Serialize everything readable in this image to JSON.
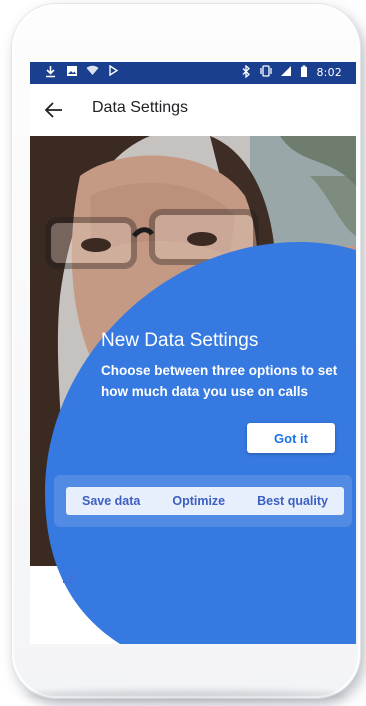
{
  "status_bar": {
    "left_icons": [
      "download-icon",
      "image-icon",
      "wifi-icon",
      "play-icon"
    ],
    "right_icons": [
      "bluetooth-icon",
      "vibrate-icon",
      "signal-icon",
      "battery-icon"
    ],
    "time": "8:02"
  },
  "app_bar": {
    "back_icon": "arrow-left-icon",
    "title": "Data Settings"
  },
  "tooltip": {
    "title": "New Data Settings",
    "body": "Choose between three options to set how much data you use on calls",
    "button_label": "Got it"
  },
  "data_options": [
    {
      "label": "Save data"
    },
    {
      "label": "Optimize"
    },
    {
      "label": "Best quality"
    }
  ],
  "learn_more_label": "Le",
  "colors": {
    "status_bar": "#1a3f8f",
    "overlay_blue": "#3679e0",
    "button_text": "#1a73e8",
    "segment_bg": "#e8effc",
    "segment_text": "#3b5fc2"
  }
}
